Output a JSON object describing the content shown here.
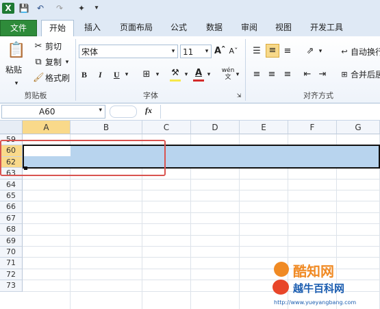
{
  "qat": {
    "app_icon": "excel-icon",
    "save": "save-icon",
    "undo": "undo-icon",
    "redo": "redo-icon",
    "customize": "customize-icon"
  },
  "tabs": [
    "文件",
    "开始",
    "插入",
    "页面布局",
    "公式",
    "数据",
    "审阅",
    "视图",
    "开发工具"
  ],
  "ribbon": {
    "clipboard": {
      "paste": "粘贴",
      "cut": "剪切",
      "copy": "复制",
      "format_painter": "格式刷",
      "label": "剪贴板"
    },
    "font": {
      "name": "宋体",
      "size": "11",
      "bold": "B",
      "italic": "I",
      "underline": "U",
      "label": "字体",
      "phonetic": "wén"
    },
    "align": {
      "wrap": "自动换行",
      "merge": "合并后居",
      "label": "对齐方式"
    }
  },
  "formula_bar": {
    "name_box": "A60",
    "fx": "fx",
    "content": ""
  },
  "grid": {
    "columns": [
      "A",
      "B",
      "C",
      "D",
      "E",
      "F",
      "G"
    ],
    "rows": [
      "59",
      "60",
      "62",
      "63",
      "64",
      "65",
      "66",
      "67",
      "68",
      "69",
      "70",
      "71",
      "72",
      "73"
    ],
    "selected_rows": [
      "60",
      "62"
    ],
    "active_cell": "A60"
  },
  "watermark": {
    "brand": "酷知网",
    "site_name": "越牛百科网",
    "url": "http://www.yueyangbang.com"
  },
  "colors": {
    "file_tab": "#2e8b3a",
    "selection": "#b8d4ee",
    "highlight_header": "#f9d98a",
    "annotation": "#d9534f"
  }
}
